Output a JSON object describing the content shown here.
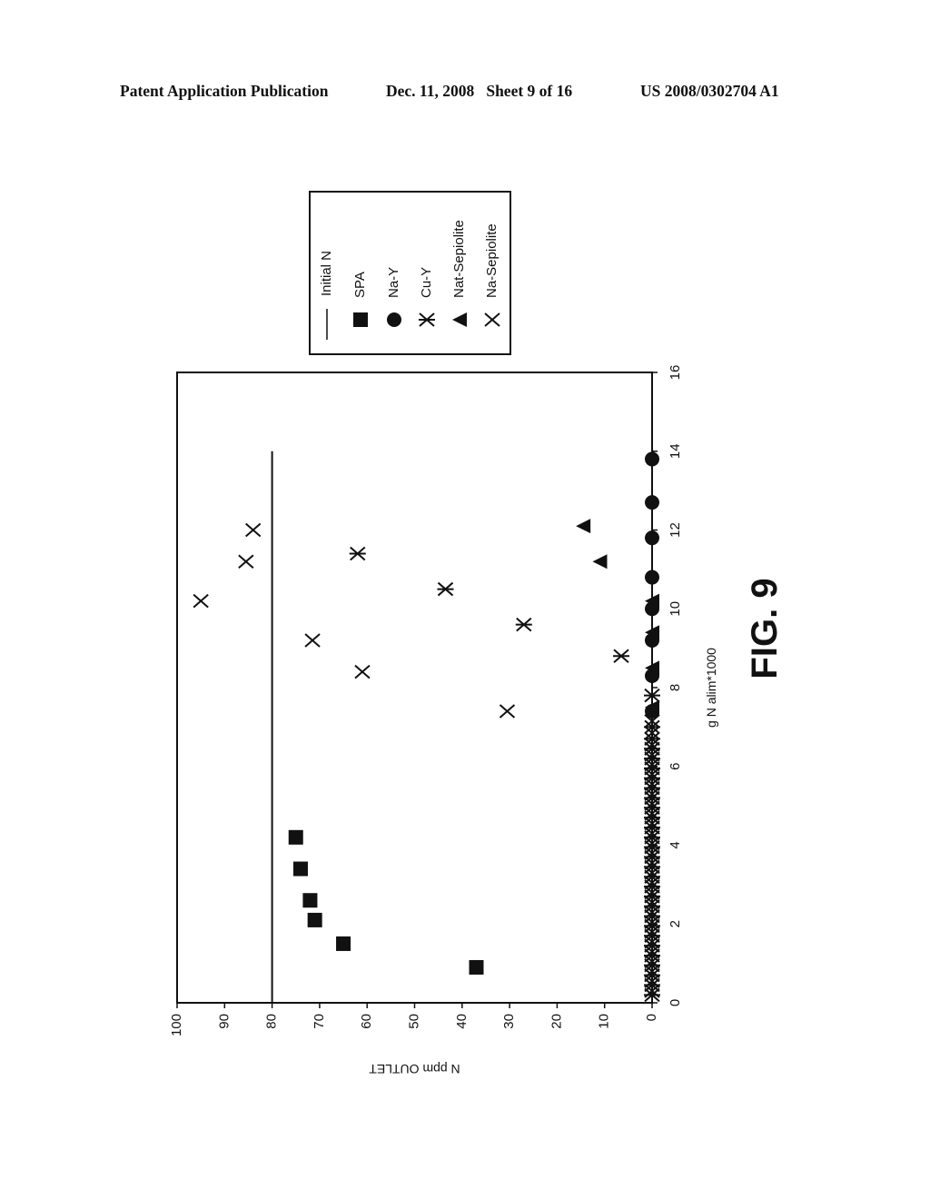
{
  "header": {
    "left": "Patent Application Publication",
    "middle": "Dec. 11, 2008   Sheet 9 of 16",
    "right": "US 2008/0302704 A1"
  },
  "figure": {
    "caption": "FIG. 9",
    "orientation": "rotated 90 degrees counter-clockwise"
  },
  "chart_data": {
    "type": "scatter",
    "title": "",
    "xlabel": "g N alim*1000",
    "ylabel": "N ppm OUTLET",
    "xlim": [
      0,
      16
    ],
    "ylim": [
      0,
      100
    ],
    "xticks": [
      0,
      2,
      4,
      6,
      8,
      10,
      12,
      14,
      16
    ],
    "yticks": [
      0,
      10,
      20,
      30,
      40,
      50,
      60,
      70,
      80,
      90,
      100
    ],
    "grid": false,
    "legend_position": "top-right",
    "legend": [
      "Initial N",
      "SPA",
      "Na-Y",
      "Cu-Y",
      "Nat-Sepiolite",
      "Na-Sepiolite"
    ],
    "series": [
      {
        "name": "Initial N",
        "marker": "line",
        "x": [
          0,
          14
        ],
        "y": [
          80,
          80
        ]
      },
      {
        "name": "SPA",
        "marker": "square",
        "x": [
          0.9,
          1.5,
          2.1,
          2.6,
          3.4,
          4.2
        ],
        "y": [
          37,
          65,
          71,
          72,
          74,
          75
        ]
      },
      {
        "name": "Na-Y",
        "marker": "circle",
        "x": [
          7.4,
          8.3,
          9.2,
          10.0,
          10.8,
          11.8,
          12.7,
          13.8
        ],
        "y": [
          0,
          0,
          0,
          0,
          0,
          0,
          0,
          0
        ]
      },
      {
        "name": "Cu-Y",
        "marker": "asterisk",
        "x": [
          0.2,
          0.45,
          0.7,
          0.95,
          1.2,
          1.45,
          1.7,
          1.95,
          2.2,
          2.45,
          2.7,
          2.95,
          3.2,
          3.45,
          3.7,
          3.95,
          4.2,
          4.45,
          4.7,
          4.95,
          5.2,
          5.45,
          5.7,
          5.95,
          6.2,
          6.45,
          6.7,
          7.0,
          7.8,
          8.8,
          9.6,
          10.5,
          11.4
        ],
        "y": [
          0,
          0,
          0,
          0,
          0,
          0,
          0,
          0,
          0,
          0,
          0,
          0,
          0,
          0,
          0,
          0,
          0,
          0,
          0,
          0,
          0,
          0,
          0,
          0,
          0,
          0,
          0,
          0,
          0,
          6.5,
          27,
          43.5,
          62
        ]
      },
      {
        "name": "Nat-Sepiolite",
        "marker": "triangle",
        "x": [
          7.5,
          8.5,
          9.4,
          10.2,
          11.2,
          12.1
        ],
        "y": [
          0,
          0,
          0,
          0,
          11,
          14.5
        ]
      },
      {
        "name": "Na-Sepiolite",
        "marker": "x",
        "x": [
          0.3,
          0.55,
          0.8,
          1.05,
          1.3,
          1.55,
          1.8,
          2.05,
          2.3,
          2.55,
          2.8,
          3.05,
          3.3,
          3.55,
          3.8,
          4.05,
          4.3,
          4.55,
          4.8,
          5.05,
          5.3,
          5.55,
          5.8,
          6.05,
          6.3,
          6.55,
          6.85,
          7.15,
          7.4,
          8.4,
          9.2,
          10.2,
          11.2,
          12.0
        ],
        "y": [
          0,
          0,
          0,
          0,
          0,
          0,
          0,
          0,
          0,
          0,
          0,
          0,
          0,
          0,
          0,
          0,
          0,
          0,
          0,
          0,
          0,
          0,
          0,
          0,
          0,
          0,
          0,
          0,
          30.5,
          61,
          71.5,
          95,
          85.5,
          84
        ]
      }
    ]
  }
}
